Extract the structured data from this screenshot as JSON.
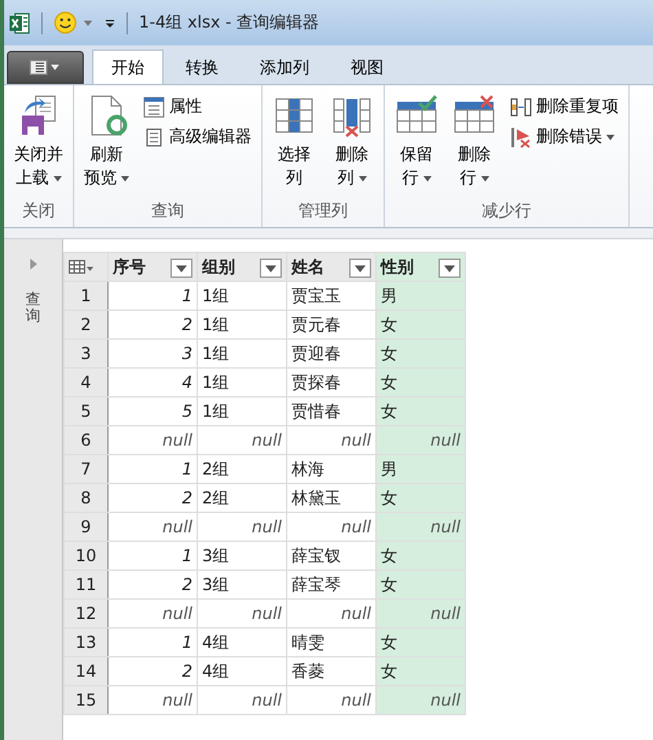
{
  "title_bar": {
    "title": "1-4组 xlsx - 查询编辑器"
  },
  "tabs": [
    {
      "label": "开始",
      "selected": true
    },
    {
      "label": "转换",
      "selected": false
    },
    {
      "label": "添加列",
      "selected": false
    },
    {
      "label": "视图",
      "selected": false
    }
  ],
  "ribbon_groups": [
    {
      "label": "关闭",
      "items": [
        {
          "kind": "large",
          "lines": [
            "关闭并",
            "上载"
          ],
          "dropdown": true
        }
      ]
    },
    {
      "label": "查询",
      "items": [
        {
          "kind": "large",
          "lines": [
            "刷新",
            "预览"
          ],
          "dropdown": true
        },
        {
          "kind": "small",
          "label": "属性",
          "dropdown": false
        },
        {
          "kind": "small",
          "label": "高级编辑器",
          "dropdown": false
        }
      ]
    },
    {
      "label": "管理列",
      "items": [
        {
          "kind": "large",
          "lines": [
            "选择",
            "列"
          ],
          "dropdown": false
        },
        {
          "kind": "large",
          "lines": [
            "删除",
            "列"
          ],
          "dropdown": true
        }
      ]
    },
    {
      "label": "减少行",
      "items": [
        {
          "kind": "large",
          "lines": [
            "保留",
            "行"
          ],
          "dropdown": true
        },
        {
          "kind": "large",
          "lines": [
            "删除",
            "行"
          ],
          "dropdown": true
        },
        {
          "kind": "small",
          "label": "删除重复项",
          "dropdown": false
        },
        {
          "kind": "small",
          "label": "删除错误",
          "dropdown": true
        }
      ]
    }
  ],
  "queries_pane": {
    "label": "查询"
  },
  "table": {
    "columns": [
      {
        "label": "序号",
        "selected": false
      },
      {
        "label": "组别",
        "selected": false
      },
      {
        "label": "姓名",
        "selected": false
      },
      {
        "label": "性别",
        "selected": true
      }
    ],
    "rows": [
      {
        "number": "1",
        "kind": "data",
        "cells": [
          "1",
          "1组",
          "贾宝玉",
          "男"
        ]
      },
      {
        "number": "2",
        "kind": "data",
        "cells": [
          "2",
          "1组",
          "贾元春",
          "女"
        ]
      },
      {
        "number": "3",
        "kind": "data",
        "cells": [
          "3",
          "1组",
          "贾迎春",
          "女"
        ]
      },
      {
        "number": "4",
        "kind": "data",
        "cells": [
          "4",
          "1组",
          "贾探春",
          "女"
        ]
      },
      {
        "number": "5",
        "kind": "data",
        "cells": [
          "5",
          "1组",
          "贾惜春",
          "女"
        ]
      },
      {
        "number": "6",
        "kind": "null",
        "cells": [
          "null",
          "null",
          "null",
          "null"
        ]
      },
      {
        "number": "7",
        "kind": "data",
        "cells": [
          "1",
          "2组",
          "林海",
          "男"
        ]
      },
      {
        "number": "8",
        "kind": "data",
        "cells": [
          "2",
          "2组",
          "林黛玉",
          "女"
        ]
      },
      {
        "number": "9",
        "kind": "null",
        "cells": [
          "null",
          "null",
          "null",
          "null"
        ]
      },
      {
        "number": "10",
        "kind": "data",
        "cells": [
          "1",
          "3组",
          "薛宝钗",
          "女"
        ]
      },
      {
        "number": "11",
        "kind": "data",
        "cells": [
          "2",
          "3组",
          "薛宝琴",
          "女"
        ]
      },
      {
        "number": "12",
        "kind": "null",
        "cells": [
          "null",
          "null",
          "null",
          "null"
        ]
      },
      {
        "number": "13",
        "kind": "data",
        "cells": [
          "1",
          "4组",
          "晴雯",
          "女"
        ]
      },
      {
        "number": "14",
        "kind": "data",
        "cells": [
          "2",
          "4组",
          "香菱",
          "女"
        ]
      },
      {
        "number": "15",
        "kind": "null",
        "cells": [
          "null",
          "null",
          "null",
          "null"
        ]
      }
    ]
  }
}
